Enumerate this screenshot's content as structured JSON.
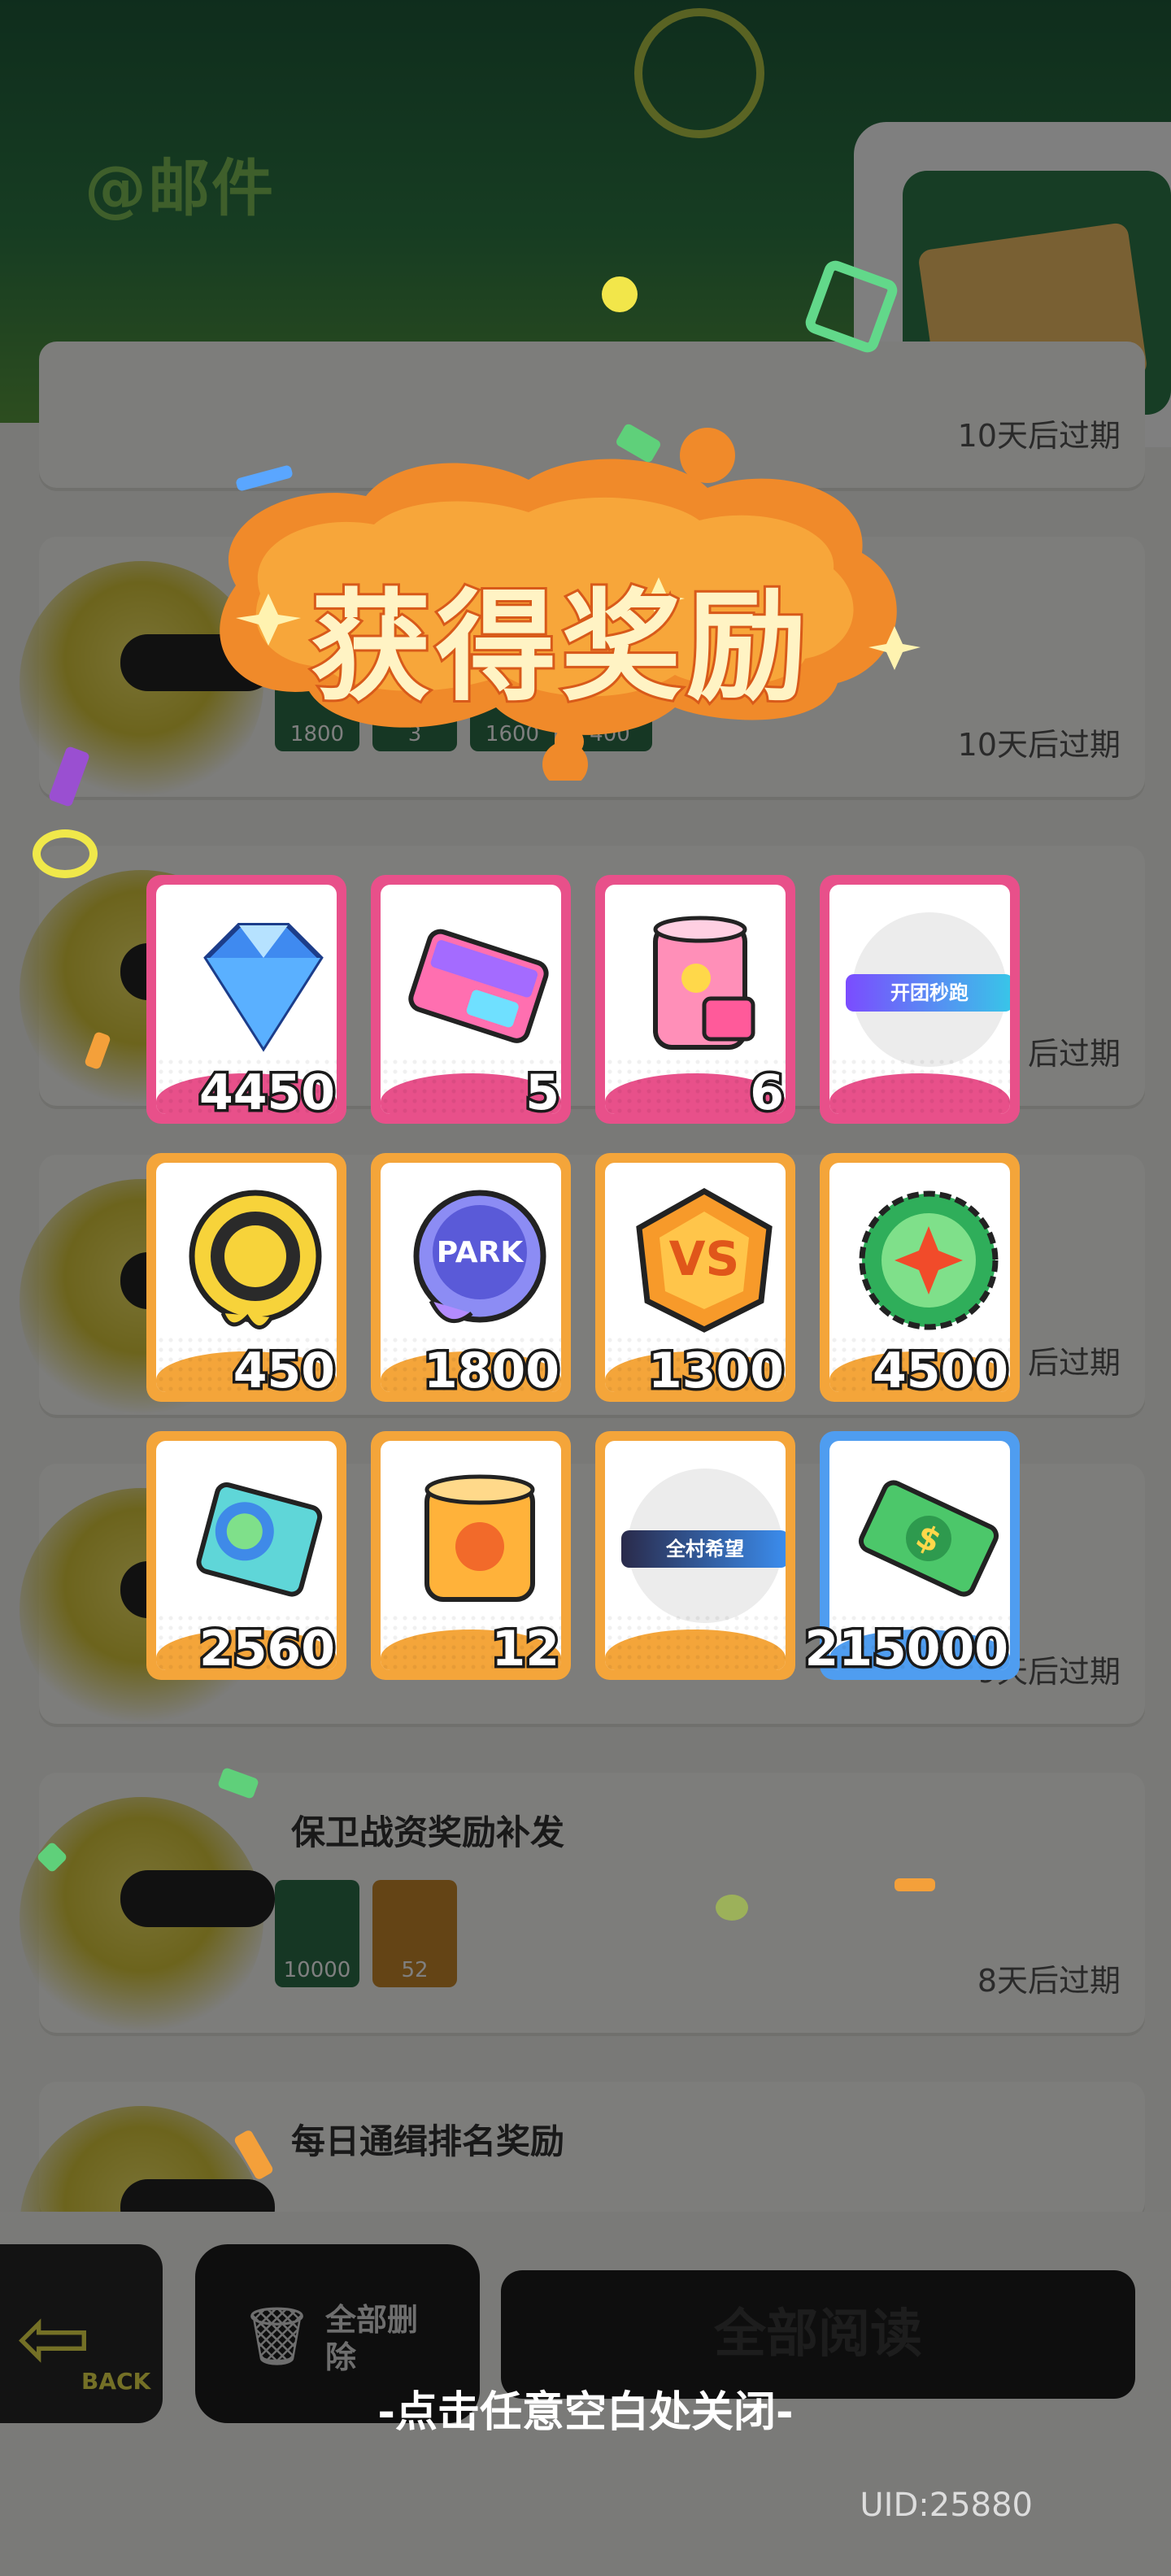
{
  "header": {
    "title": "@邮件"
  },
  "mails": [
    {
      "title": "",
      "expiry": "10天后过期",
      "items": []
    },
    {
      "title": "",
      "expiry": "10天后过期",
      "items": [
        {
          "count": "1800"
        },
        {
          "count": "3"
        },
        {
          "count": "1600"
        },
        {
          "count": "400"
        }
      ]
    },
    {
      "title": "",
      "expiry": "后过期",
      "items": []
    },
    {
      "title": "",
      "expiry": "后过期",
      "items": []
    },
    {
      "title": "",
      "expiry": "9天后过期",
      "items": []
    },
    {
      "title": "保卫战资奖励补发",
      "expiry": "8天后过期",
      "items": [
        {
          "count": "10000"
        },
        {
          "count": "52"
        }
      ]
    },
    {
      "title": "每日通缉排名奖励",
      "expiry": "",
      "items": []
    }
  ],
  "bottom": {
    "back_label": "BACK",
    "delete_all_label": "全部删除",
    "read_all_label": "全部阅读"
  },
  "popup": {
    "title": "获得奖励",
    "rewards": [
      {
        "icon": "blue-diamond-icon",
        "count": "4450",
        "rarity": "pink"
      },
      {
        "icon": "pink-card-icon",
        "count": "5",
        "rarity": "pink"
      },
      {
        "icon": "pink-can-icon",
        "count": "6",
        "rarity": "pink"
      },
      {
        "icon": "title-tag-icon",
        "count": "",
        "label": "开团秒跑",
        "rarity": "pink"
      },
      {
        "icon": "yellow-badge-coin-icon",
        "count": "450",
        "rarity": "orange"
      },
      {
        "icon": "park-coin-icon",
        "count": "1800",
        "rarity": "orange"
      },
      {
        "icon": "vs-token-icon",
        "count": "1300",
        "rarity": "orange"
      },
      {
        "icon": "bottle-cap-icon",
        "count": "4500",
        "rarity": "orange"
      },
      {
        "icon": "season-ticket-icon",
        "count": "2560",
        "rarity": "orange"
      },
      {
        "icon": "orange-can-icon",
        "count": "12",
        "rarity": "orange"
      },
      {
        "icon": "title-tag-icon",
        "count": "",
        "label": "全村希望",
        "rarity": "orange"
      },
      {
        "icon": "cash-bill-icon",
        "count": "215000",
        "rarity": "blue"
      }
    ],
    "close_hint": "-点击任意空白处关闭-"
  },
  "uid": "UID:25880",
  "colors": {
    "pink": "#e8508a",
    "orange": "#f4a53a",
    "blue": "#4f9df0",
    "accent": "#f0902a"
  }
}
